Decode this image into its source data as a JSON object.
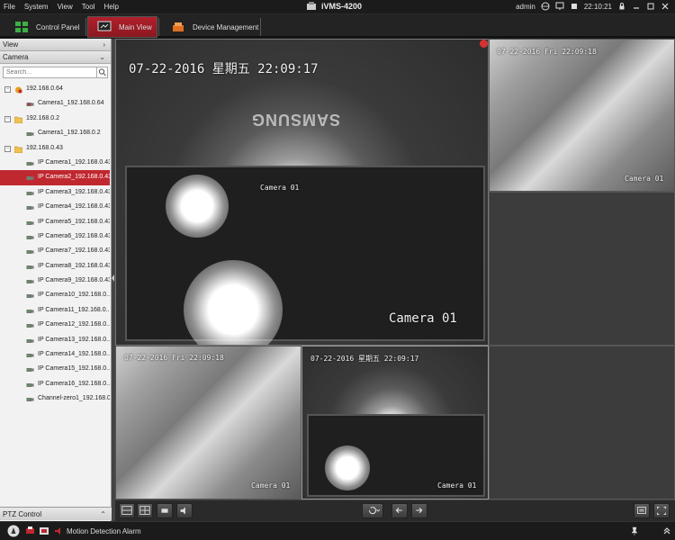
{
  "titlebar": {
    "menu": [
      "File",
      "System",
      "View",
      "Tool",
      "Help"
    ],
    "app_title": "iVMS-4200",
    "user": "admin",
    "time": "22:10:21"
  },
  "tabs": [
    {
      "label": "Control Panel",
      "active": false
    },
    {
      "label": "Main View",
      "active": true
    },
    {
      "label": "Device Management",
      "active": false
    }
  ],
  "sidebar": {
    "view_header": "View",
    "camera_header": "Camera",
    "search_placeholder": "Search...",
    "tree": [
      {
        "label": "192.168.0.64",
        "level": 0,
        "type": "device",
        "expanded": true
      },
      {
        "label": "Camera1_192.168.0.64",
        "level": 1,
        "type": "camera-alert"
      },
      {
        "label": "192.168.0.2",
        "level": 0,
        "type": "folder",
        "expanded": true
      },
      {
        "label": "Camera1_192.168.0.2",
        "level": 1,
        "type": "camera"
      },
      {
        "label": "192.168.0.43",
        "level": 0,
        "type": "folder",
        "expanded": true
      },
      {
        "label": "IP Camera1_192.168.0.43",
        "level": 1,
        "type": "camera"
      },
      {
        "label": "IP Camera2_192.168.0.43",
        "level": 1,
        "type": "camera",
        "selected": true
      },
      {
        "label": "IP Camera3_192.168.0.43",
        "level": 1,
        "type": "camera"
      },
      {
        "label": "IP Camera4_192.168.0.43",
        "level": 1,
        "type": "camera"
      },
      {
        "label": "IP Camera5_192.168.0.43",
        "level": 1,
        "type": "camera"
      },
      {
        "label": "IP Camera6_192.168.0.43",
        "level": 1,
        "type": "camera"
      },
      {
        "label": "IP Camera7_192.168.0.43",
        "level": 1,
        "type": "camera"
      },
      {
        "label": "IP Camera8_192.168.0.43",
        "level": 1,
        "type": "camera"
      },
      {
        "label": "IP Camera9_192.168.0.43",
        "level": 1,
        "type": "camera"
      },
      {
        "label": "IP Camera10_192.168.0...",
        "level": 1,
        "type": "camera"
      },
      {
        "label": "IP Camera11_192.168.0...",
        "level": 1,
        "type": "camera"
      },
      {
        "label": "IP Camera12_192.168.0...",
        "level": 1,
        "type": "camera"
      },
      {
        "label": "IP Camera13_192.168.0...",
        "level": 1,
        "type": "camera"
      },
      {
        "label": "IP Camera14_192.168.0...",
        "level": 1,
        "type": "camera"
      },
      {
        "label": "IP Camera15_192.168.0...",
        "level": 1,
        "type": "camera"
      },
      {
        "label": "IP Camera16_192.168.0...",
        "level": 1,
        "type": "camera"
      },
      {
        "label": "Channel-zero1_192.168.0...",
        "level": 1,
        "type": "camera"
      }
    ],
    "ptz_header": "PTZ Control"
  },
  "panes": {
    "main": {
      "osd": "07-22-2016 星期五 22:09:17",
      "name": "Camera 01",
      "brand": "SAMSUNG",
      "inner_name": "Camera 01"
    },
    "top_right": {
      "osd": "07-22-2016 Fri 22:09:18",
      "name": "Camera 01"
    },
    "bottom_left": {
      "osd": "07-22-2016 Fri 22:09:18",
      "name": "Camera 01"
    },
    "bottom_mid": {
      "osd": "07-22-2016 星期五 22:09:17",
      "name": "Camera 01"
    }
  },
  "status": {
    "alarm_text": "Motion Detection Alarm"
  },
  "colors": {
    "accent": "#b0202a",
    "selection": "#c02830"
  }
}
